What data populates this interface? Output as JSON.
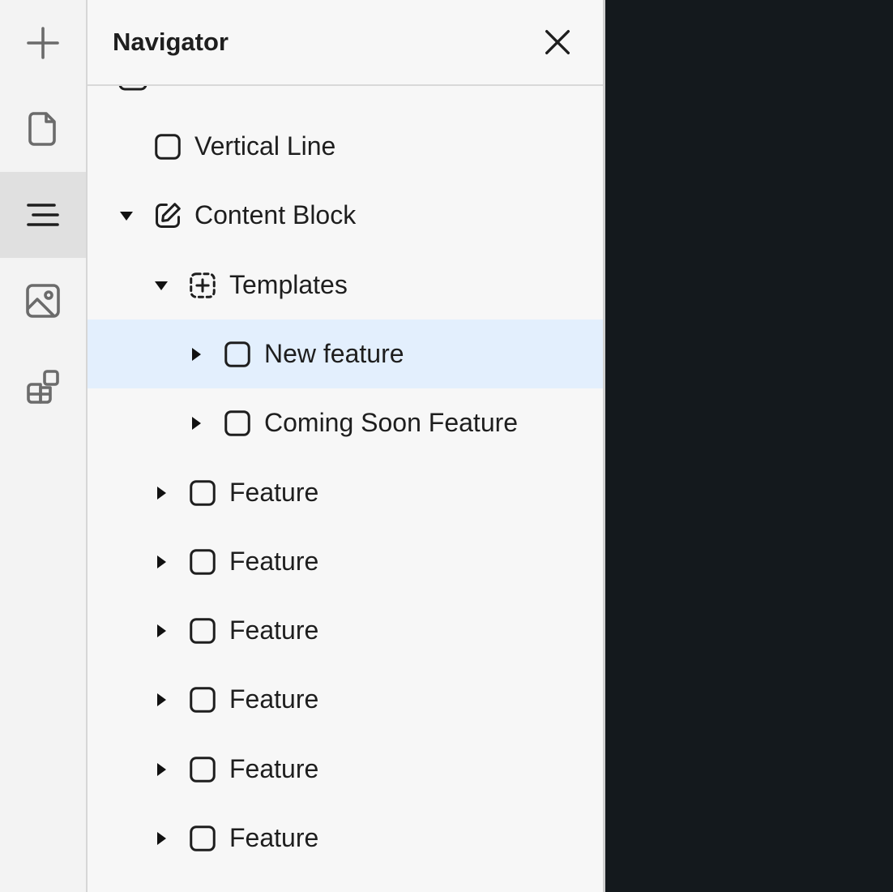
{
  "rail": {
    "items": [
      {
        "icon": "plus-icon",
        "label": "Add"
      },
      {
        "icon": "page-icon",
        "label": "Pages"
      },
      {
        "icon": "navigator-icon",
        "label": "Navigator",
        "active": true
      },
      {
        "icon": "image-icon",
        "label": "Assets"
      },
      {
        "icon": "components-icon",
        "label": "Components"
      }
    ]
  },
  "navigator": {
    "title": "Navigator",
    "close_icon": "close-icon"
  },
  "tree": {
    "items": [
      {
        "label": "Vertical Line",
        "icon": "box-icon",
        "caret": "none"
      },
      {
        "label": "Content Block",
        "icon": "edit-icon",
        "caret": "expanded"
      },
      {
        "label": "Templates",
        "icon": "dashed-add-icon",
        "caret": "expanded"
      },
      {
        "label": "New feature",
        "icon": "box-icon",
        "caret": "collapsed",
        "selected": true
      },
      {
        "label": "Coming Soon Feature",
        "icon": "box-icon",
        "caret": "collapsed"
      },
      {
        "label": "Feature",
        "icon": "box-icon",
        "caret": "collapsed"
      },
      {
        "label": "Feature",
        "icon": "box-icon",
        "caret": "collapsed"
      },
      {
        "label": "Feature",
        "icon": "box-icon",
        "caret": "collapsed"
      },
      {
        "label": "Feature",
        "icon": "box-icon",
        "caret": "collapsed"
      },
      {
        "label": "Feature",
        "icon": "box-icon",
        "caret": "collapsed"
      },
      {
        "label": "Feature",
        "icon": "box-icon",
        "caret": "collapsed"
      }
    ]
  },
  "colors": {
    "selected_row": "#e3effd",
    "canvas": "#14191d",
    "panel": "#f7f7f7"
  }
}
